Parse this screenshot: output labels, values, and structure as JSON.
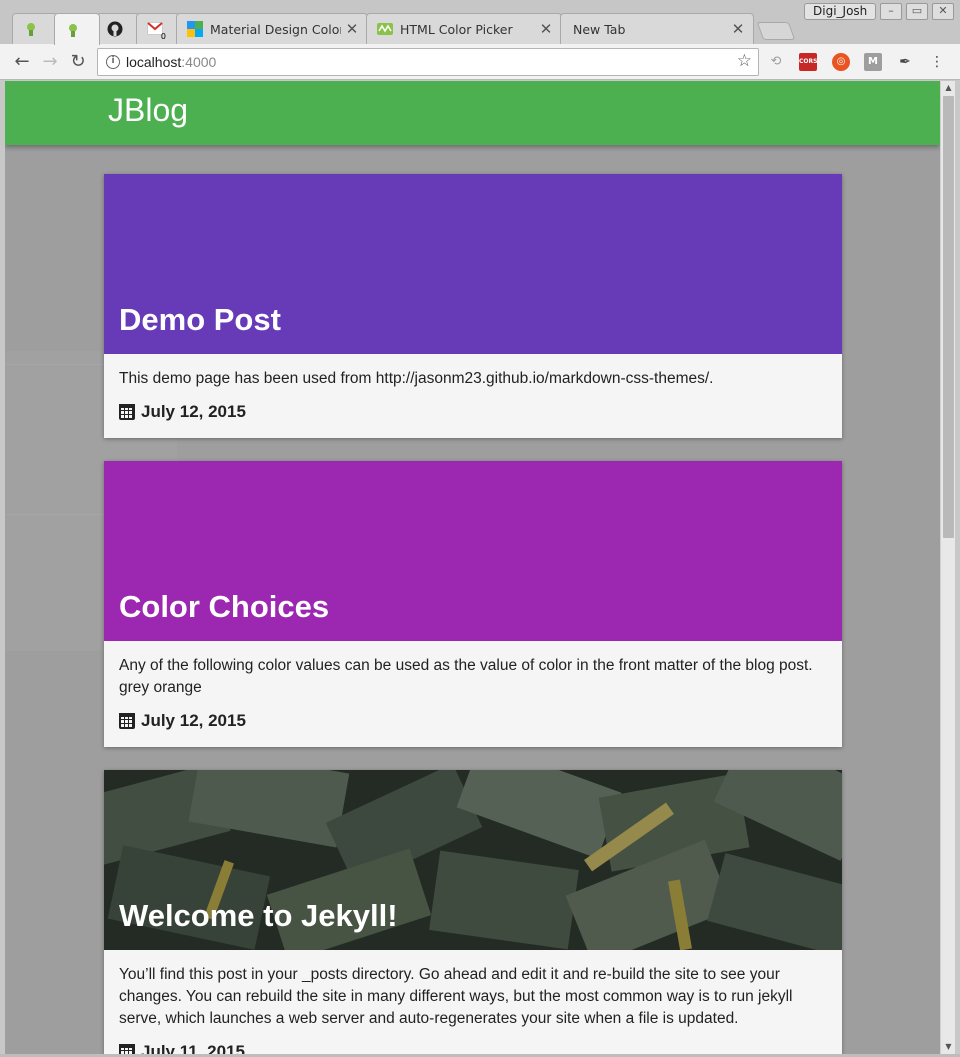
{
  "tabs": [
    {
      "title": "",
      "icon": "jekyll-icon",
      "active": false
    },
    {
      "title": "",
      "icon": "jekyll-icon",
      "active": true
    },
    {
      "title": "",
      "icon": "github-icon",
      "active": false
    },
    {
      "title": "",
      "icon": "gmail-icon",
      "badge": "0",
      "active": false
    },
    {
      "title": "Material Design Color",
      "icon": "material-palette-icon",
      "active": false
    },
    {
      "title": "HTML Color Picker",
      "icon": "color-picker-icon",
      "active": false
    },
    {
      "title": "New Tab",
      "icon": "",
      "active": false
    }
  ],
  "window": {
    "profile_name": "Digi_Josh"
  },
  "toolbar": {
    "url_host": "localhost",
    "url_port": ":4000",
    "extensions": [
      "link-icon",
      "cors-icon",
      "ubuntu-icon",
      "m-icon",
      "eyedropper-icon"
    ],
    "ext_cors_label": "CORS",
    "ext_m_label": "M"
  },
  "site": {
    "brand": "JBlog",
    "brand_color": "#4caf50"
  },
  "posts": [
    {
      "title": "Demo Post",
      "color": "#673ab7",
      "excerpt": "This demo page has been used from http://jasonm23.github.io/markdown-css-themes/.",
      "date": "July 12, 2015"
    },
    {
      "title": "Color Choices",
      "color": "#9c27b0",
      "excerpt": "Any of the following color values can be used as the value of color in the front matter of the blog post. grey orange",
      "date": "July 12, 2015"
    },
    {
      "title": "Welcome to Jekyll!",
      "color": "#3b4a3b",
      "excerpt": "You’ll find this post in your _posts directory. Go ahead and edit it and re-build the site to see your changes. You can rebuild the site in many different ways, but the most common way is to run jekyll serve, which launches a web server and auto-regenerates your site when a file is updated.",
      "date": "July 11, 2015"
    }
  ]
}
